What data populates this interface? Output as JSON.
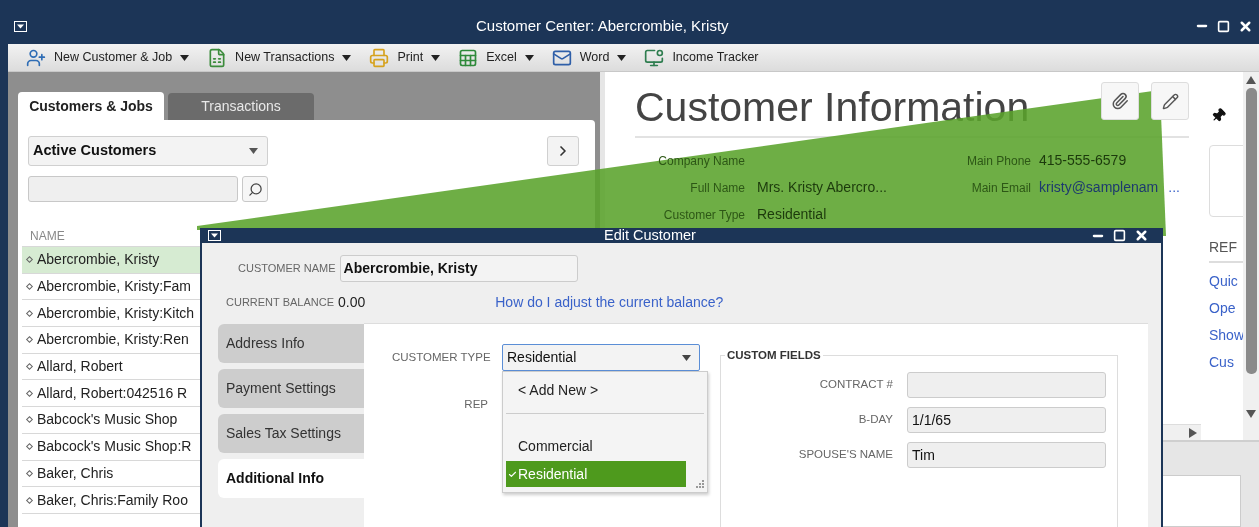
{
  "window": {
    "title": "Customer Center: Abercrombie, Kristy"
  },
  "toolbar": [
    {
      "kind": "customer",
      "label": "New Customer & Job",
      "has_menu": true
    },
    {
      "kind": "transactions",
      "label": "New Transactions",
      "has_menu": true
    },
    {
      "kind": "print",
      "label": "Print",
      "has_menu": true
    },
    {
      "kind": "excel",
      "label": "Excel",
      "has_menu": true
    },
    {
      "kind": "word",
      "label": "Word",
      "has_menu": true
    },
    {
      "kind": "tracker",
      "label": "Income Tracker",
      "has_menu": false
    }
  ],
  "left_panel": {
    "tabs": [
      {
        "label": "Customers & Jobs",
        "selected": true
      },
      {
        "label": "Transactions",
        "selected": false
      }
    ],
    "filter": {
      "value": "Active Customers"
    },
    "column": "NAME",
    "rows": [
      {
        "name": "Abercrombie, Kristy",
        "selected": true
      },
      {
        "name": "Abercrombie, Kristy:Fam",
        "selected": false
      },
      {
        "name": "Abercrombie, Kristy:Kitch",
        "selected": false
      },
      {
        "name": "Abercrombie, Kristy:Ren",
        "selected": false
      },
      {
        "name": "Allard, Robert",
        "selected": false
      },
      {
        "name": "Allard, Robert:042516 R",
        "selected": false
      },
      {
        "name": "Babcock's Music Shop",
        "selected": false
      },
      {
        "name": "Babcock's Music Shop:R",
        "selected": false
      },
      {
        "name": "Baker, Chris",
        "selected": false
      },
      {
        "name": "Baker, Chris:Family Roo",
        "selected": false
      }
    ]
  },
  "customer_info": {
    "title": "Customer Information",
    "left_fields": [
      {
        "label": "Company Name"
      },
      {
        "label": "Full Name",
        "value": "Mrs. Kristy Abercro..."
      },
      {
        "label": "Customer Type",
        "value": "Residential"
      }
    ],
    "right_fields": [
      {
        "label": "Main Phone",
        "value": "415-555-6579"
      },
      {
        "label": "Main Email",
        "value": "kristy@samplenam",
        "more": "..."
      }
    ],
    "reports_heading": "REF",
    "links": [
      "Quic",
      "Ope",
      "Show",
      "Cus"
    ]
  },
  "dialog": {
    "title": "Edit Customer",
    "customer_name": {
      "label": "CUSTOMER NAME",
      "value": "Abercrombie, Kristy"
    },
    "current_balance": {
      "label": "CURRENT BALANCE",
      "value": "0.00"
    },
    "help_link": "How do I adjust the current balance?",
    "tabs": [
      {
        "label": "Address Info",
        "selected": false
      },
      {
        "label": "Payment Settings",
        "selected": false
      },
      {
        "label": "Sales Tax Settings",
        "selected": false
      },
      {
        "label": "Additional Info",
        "selected": true
      }
    ],
    "customer_type": {
      "label": "CUSTOMER TYPE",
      "value": "Residential",
      "options": [
        {
          "kind": "action",
          "label": "< Add New >",
          "selected": false
        },
        {
          "kind": "item",
          "label": "Commercial",
          "selected": false
        },
        {
          "kind": "item",
          "label": "Residential",
          "selected": true
        }
      ]
    },
    "rep": {
      "label": "REP"
    },
    "custom_fields": {
      "title": "CUSTOM FIELDS",
      "fields": [
        {
          "label": "CONTRACT #"
        },
        {
          "label": "B-DAY",
          "value": "1/1/65"
        },
        {
          "label": "SPOUSE'S NAME",
          "value": "Tim"
        }
      ]
    }
  }
}
